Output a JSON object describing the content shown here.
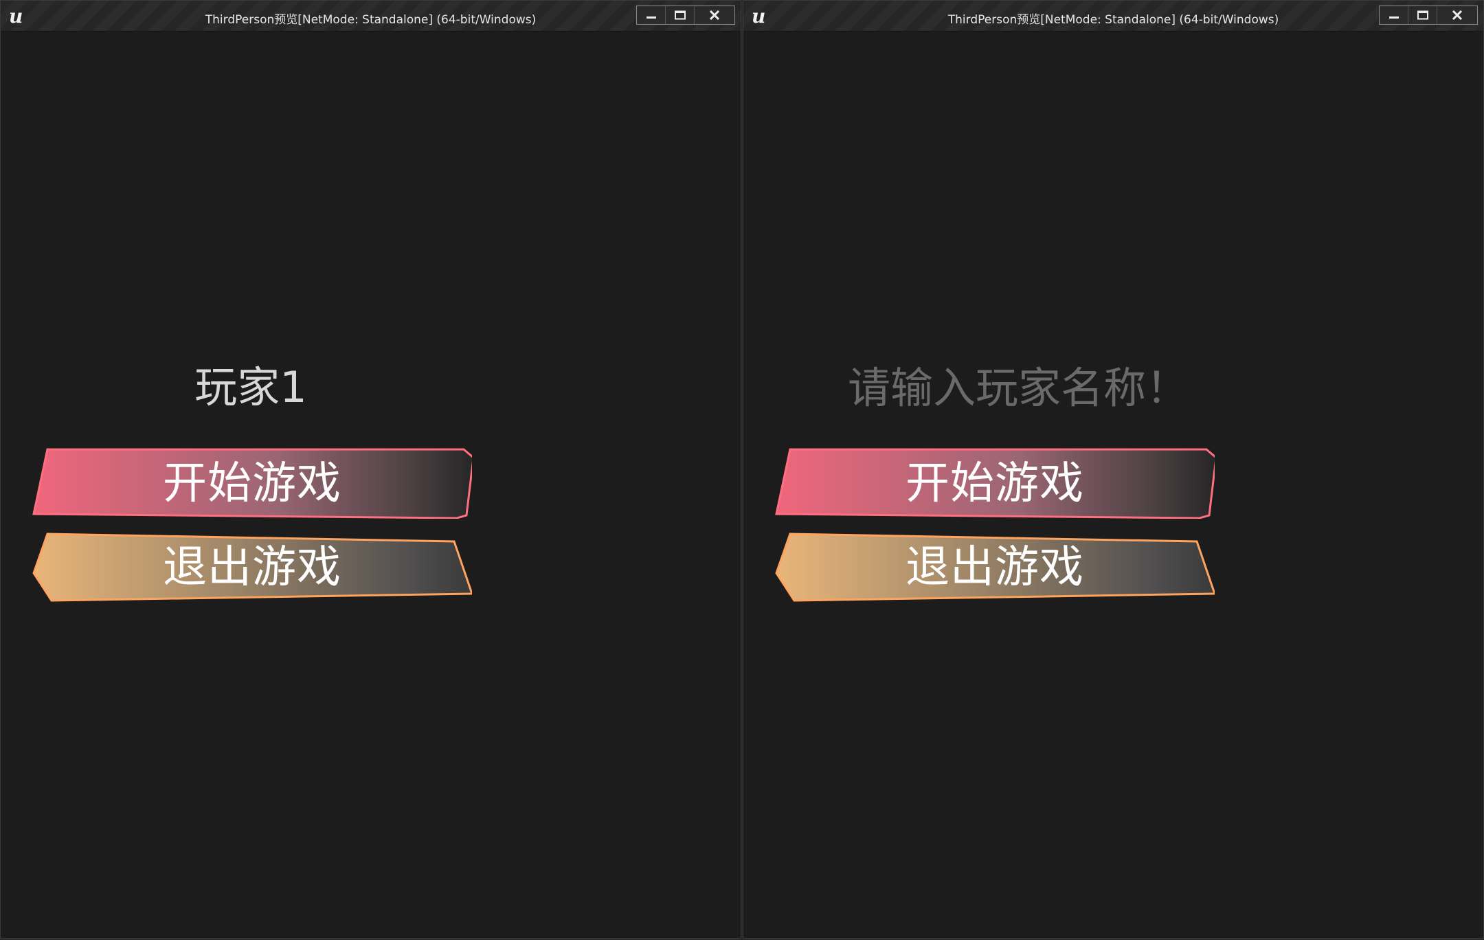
{
  "windows": [
    {
      "title": "ThirdPerson预览[NetMode: Standalone]  (64-bit/Windows)",
      "player_name": "玩家1",
      "buttons": {
        "start": "开始游戏",
        "quit": "退出游戏"
      }
    },
    {
      "title": "ThirdPerson预览[NetMode: Standalone]  (64-bit/Windows)",
      "name_placeholder": "请输入玩家名称！",
      "buttons": {
        "start": "开始游戏",
        "quit": "退出游戏"
      }
    }
  ],
  "icons": {
    "logo": "unreal-engine-logo",
    "minimize": "minimize-icon",
    "maximize": "maximize-icon",
    "close": "close-icon"
  },
  "colors": {
    "background": "#1c1c1c",
    "start_gradient_start": "#f0667c",
    "start_gradient_end": "#2e2e2e",
    "quit_gradient_start": "#e9b67a",
    "quit_gradient_end": "#3c3c3c",
    "start_border": "#ff6f7f",
    "quit_border": "#ffa45e"
  }
}
